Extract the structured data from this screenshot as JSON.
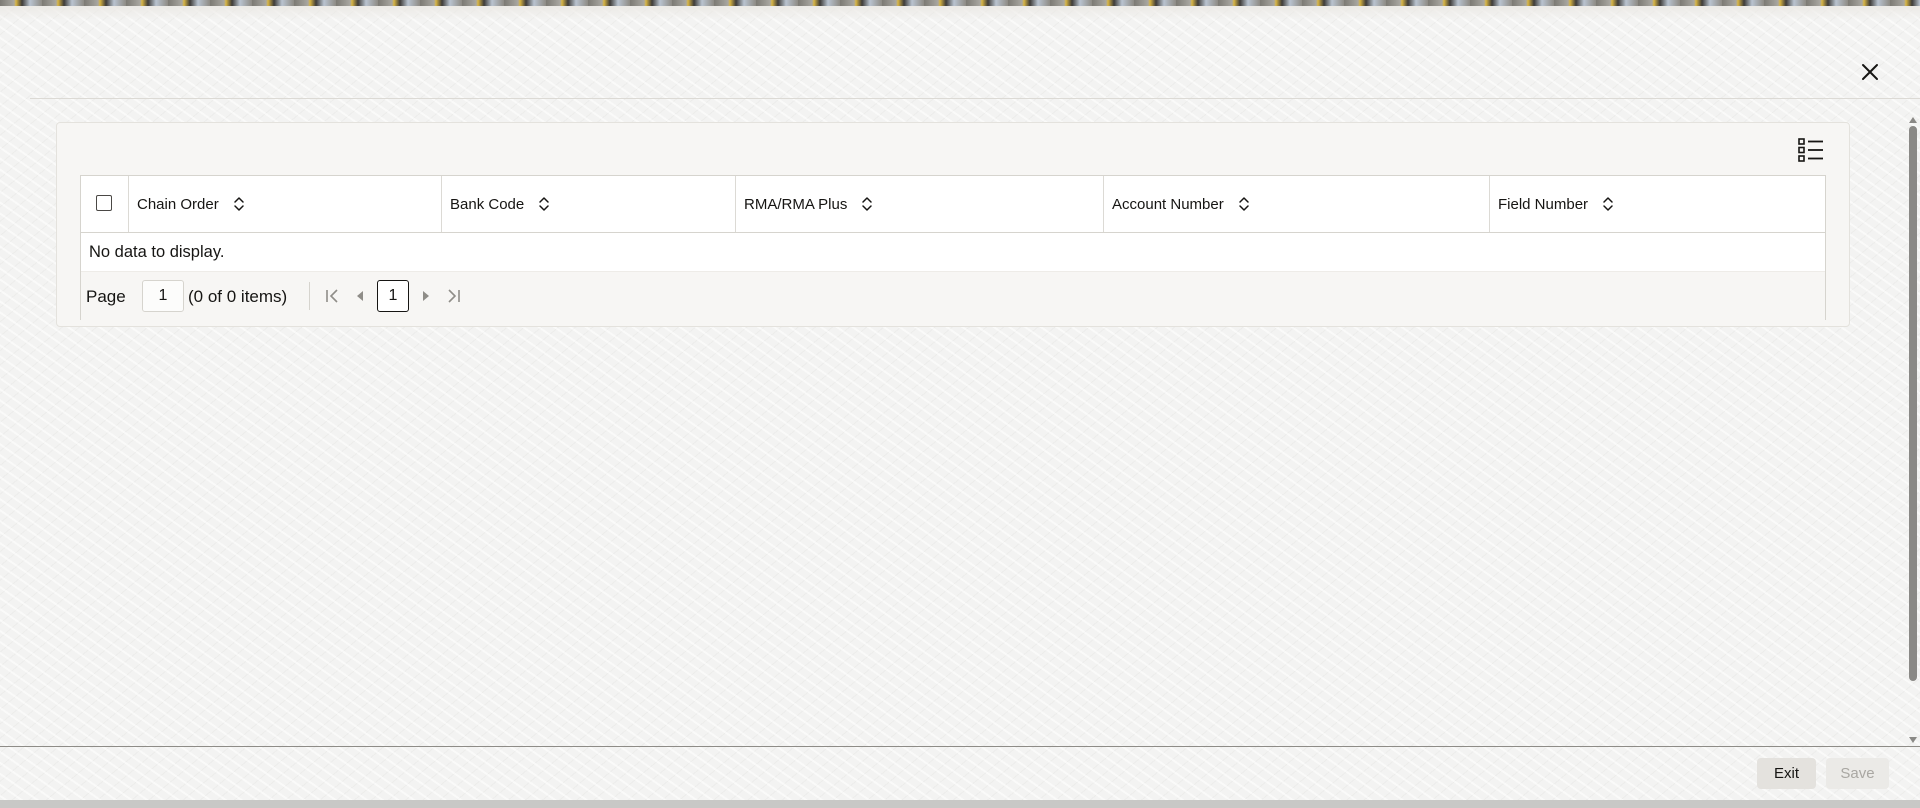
{
  "window": {
    "close_icon": "close-icon"
  },
  "toolbar": {
    "column_manager_icon": "list-settings-icon"
  },
  "grid": {
    "select_all_icon": "checkbox-icon",
    "columns": [
      {
        "label": "Chain Order",
        "sort_icon": "sort-icon"
      },
      {
        "label": "Bank Code",
        "sort_icon": "sort-icon"
      },
      {
        "label": "RMA/RMA Plus",
        "sort_icon": "sort-icon"
      },
      {
        "label": "Account Number",
        "sort_icon": "sort-icon"
      },
      {
        "label": "Field Number",
        "sort_icon": "sort-icon"
      }
    ],
    "rows": [],
    "empty_message": "No data to display."
  },
  "pagination": {
    "page_label": "Page",
    "page_input_value": "1",
    "item_count": "(0 of 0 items)",
    "current_page": "1",
    "icons": [
      "first-page-icon",
      "previous-page-icon",
      "next-page-icon",
      "last-page-icon"
    ]
  },
  "footer": {
    "exit_label": "Exit",
    "save_label": "Save"
  },
  "colors": {
    "background": "#f3f3f2",
    "panel": "#f7f6f4",
    "border": "#d6d4ce",
    "text": "#161513",
    "disabled_text": "#a9a7a2",
    "scrollbar": "#8a8986"
  }
}
